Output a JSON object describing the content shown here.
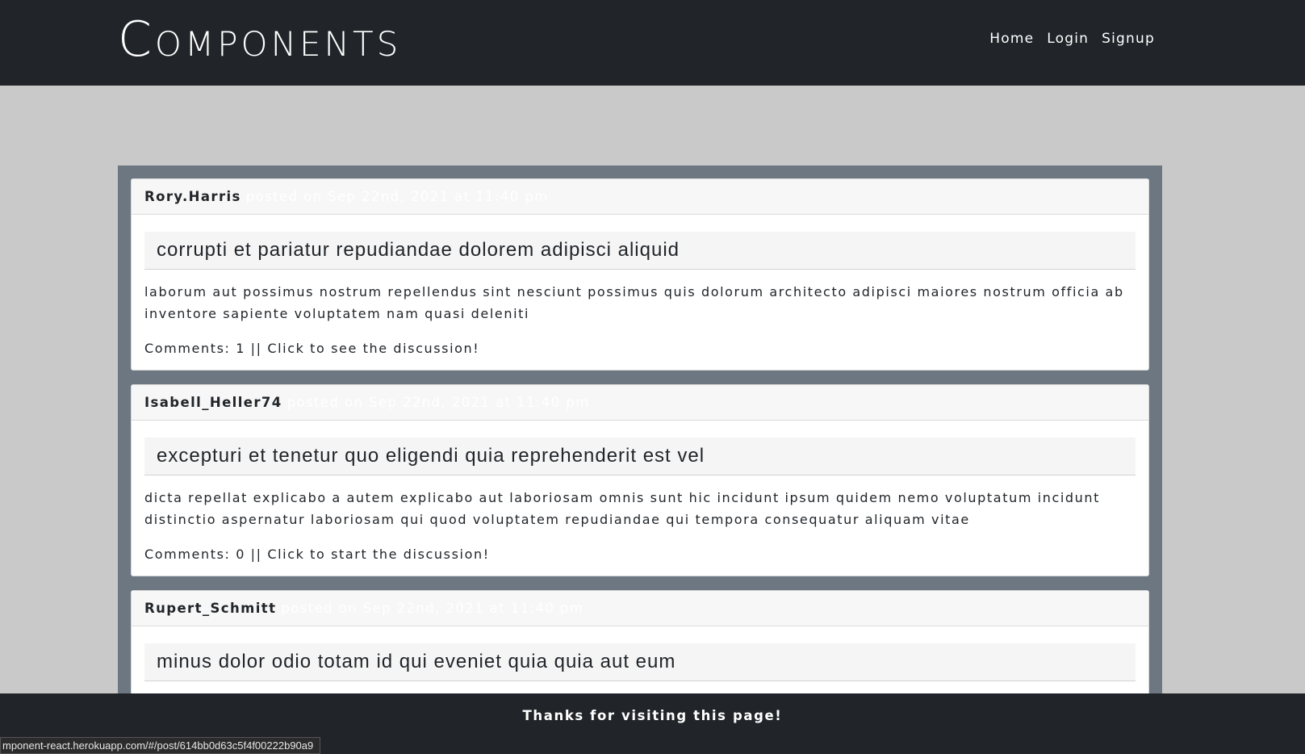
{
  "header": {
    "logo": "Components",
    "nav": [
      "Home",
      "Login",
      "Signup"
    ]
  },
  "posts": [
    {
      "author": "Rory.Harris",
      "posted": "posted on Sep 22nd, 2021 at 11:40 pm",
      "title": "corrupti et pariatur repudiandae dolorem adipisci aliquid",
      "body": "laborum aut possimus nostrum repellendus sint nesciunt possimus quis dolorum architecto adipisci maiores nostrum officia ab inventore sapiente voluptatem nam quasi deleniti",
      "comments": "Comments: 1 || Click to see the discussion!"
    },
    {
      "author": "Isabell_Heller74",
      "posted": "posted on Sep 22nd, 2021 at 11:40 pm",
      "title": "excepturi et tenetur quo eligendi quia reprehenderit est vel",
      "body": "dicta repellat explicabo a autem explicabo aut laboriosam omnis sunt hic incidunt ipsum quidem nemo voluptatum incidunt distinctio aspernatur laboriosam qui quod voluptatem repudiandae qui tempora consequatur aliquam vitae",
      "comments": "Comments: 0 || Click to start the discussion!"
    },
    {
      "author": "Rupert_Schmitt",
      "posted": "posted on Sep 22nd, 2021 at 11:40 pm",
      "title": "minus dolor odio totam id qui eveniet quia quia aut eum",
      "body": "",
      "comments": ""
    }
  ],
  "footer": {
    "text": "Thanks for visiting this page!"
  },
  "status_bar": {
    "url": "mponent-react.herokuapp.com/#/post/614bb0d63c5f4f00222b90a9"
  }
}
